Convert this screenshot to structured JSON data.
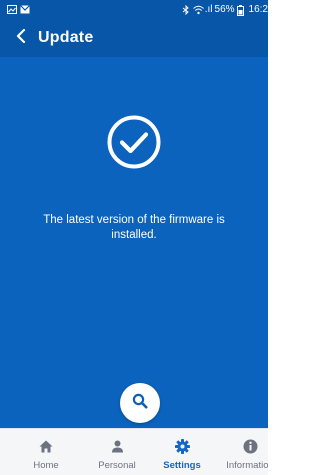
{
  "status_bar": {
    "signal_text": ".ıl",
    "battery_percent": "56%",
    "time": "16:2"
  },
  "header": {
    "title": "Update"
  },
  "main": {
    "message": "The latest version of the firmware is installed."
  },
  "bottom_nav": {
    "items": [
      {
        "label": "Home",
        "icon": "home-icon"
      },
      {
        "label": "Personal",
        "icon": "person-icon"
      },
      {
        "label": "Settings",
        "icon": "gear-icon"
      },
      {
        "label": "Information",
        "icon": "info-icon"
      }
    ],
    "active_label": "Settings"
  },
  "colors": {
    "header_bg": "#0756a8",
    "main_bg": "#0b63bd",
    "nav_bg": "#f5f6f8",
    "active_accent": "#1467c4",
    "nav_inactive": "#6c7380"
  }
}
